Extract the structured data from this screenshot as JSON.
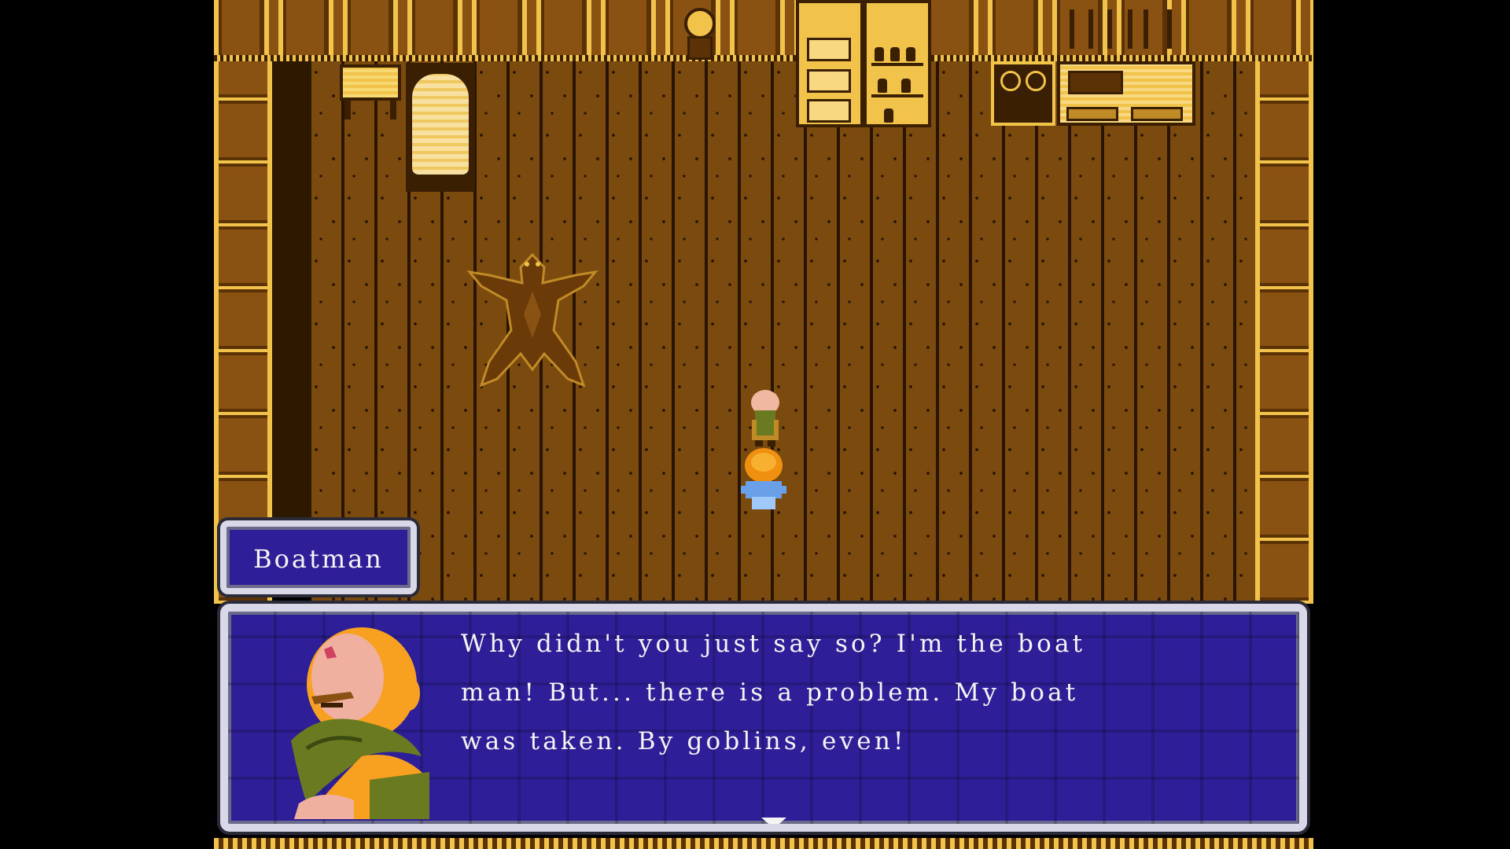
{
  "scene": {
    "location": "",
    "colors": {
      "wood_dark": "#3a1f02",
      "wood_mid": "#7a4a0e",
      "wood_light": "#f2c34a",
      "dialog_bg": "#2e1f99",
      "dialog_border": "#d8d8e8",
      "text": "#f4f4f4"
    }
  },
  "name_box": {
    "speaker": "Boatman"
  },
  "dialog": {
    "lines": [
      "Why didn't you just say so? I'm the boat",
      "man! But... there is a problem. My boat",
      "was taken. By goblins, even!"
    ],
    "continue_icon": "down-triangle-icon"
  },
  "characters": {
    "npc": "boatman-sprite",
    "player": "hero-sprite",
    "portrait": "boatman-portrait"
  }
}
